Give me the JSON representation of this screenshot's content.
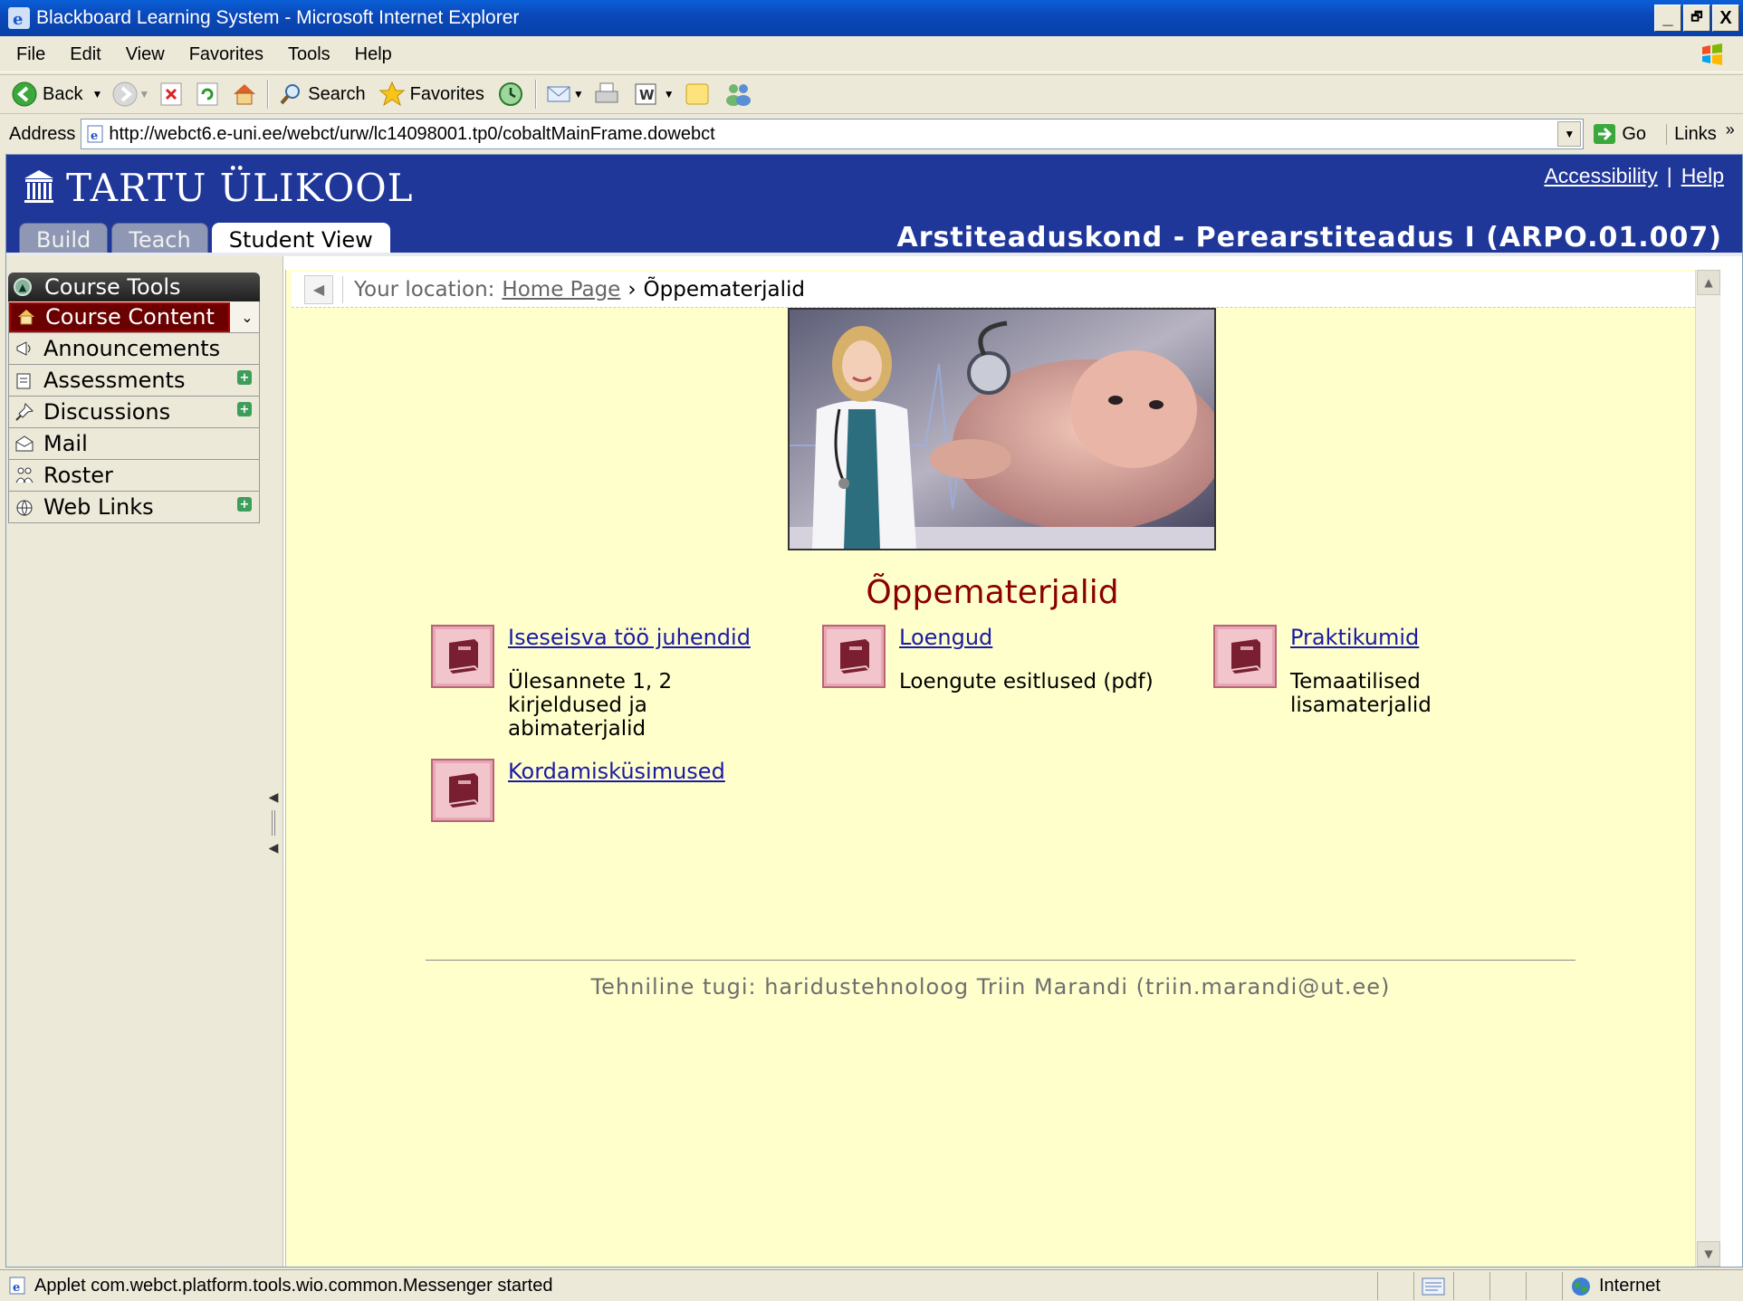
{
  "window": {
    "title": "Blackboard Learning System - Microsoft Internet Explorer",
    "buttons": {
      "minimize": "_",
      "restore": "🗗",
      "close": "X"
    }
  },
  "menu": [
    "File",
    "Edit",
    "View",
    "Favorites",
    "Tools",
    "Help"
  ],
  "toolbar": {
    "back": "Back",
    "search": "Search",
    "favorites": "Favorites"
  },
  "address": {
    "label": "Address",
    "url": "http://webct6.e-uni.ee/webct/urw/lc14098001.tp0/cobaltMainFrame.dowebct",
    "go": "Go",
    "links": "Links"
  },
  "header": {
    "logo": "TARTU ÜLIKOOL",
    "accessibility": "Accessibility",
    "separator": "|",
    "help": "Help",
    "tabs": [
      {
        "label": "Build",
        "active": false
      },
      {
        "label": "Teach",
        "active": false
      },
      {
        "label": "Student View",
        "active": true
      }
    ],
    "course_title": "Arstiteaduskond - Perearstiteadus I (ARPO.01.007)"
  },
  "course_tools": {
    "heading": "Course Tools",
    "items": [
      {
        "label": "Course Content",
        "icon": "home-icon",
        "active": true,
        "plus": false
      },
      {
        "label": "Announcements",
        "icon": "megaphone-icon",
        "active": false,
        "plus": false
      },
      {
        "label": "Assessments",
        "icon": "assessment-icon",
        "active": false,
        "plus": true
      },
      {
        "label": "Discussions",
        "icon": "pin-icon",
        "active": false,
        "plus": true
      },
      {
        "label": "Mail",
        "icon": "mail-icon",
        "active": false,
        "plus": false
      },
      {
        "label": "Roster",
        "icon": "people-icon",
        "active": false,
        "plus": false
      },
      {
        "label": "Web Links",
        "icon": "globe-icon",
        "active": false,
        "plus": true
      }
    ]
  },
  "breadcrumb": {
    "prefix": "Your location:",
    "home": "Home Page",
    "arrow": "›",
    "current": "Õppematerjalid"
  },
  "content": {
    "heading": "Õppematerjalid",
    "folders": [
      {
        "title": "Iseseisva töö juhendid",
        "description": "Ülesannete 1, 2 kirjeldused ja abimaterjalid"
      },
      {
        "title": "Loengud",
        "description": "Loengute esitlused (pdf)"
      },
      {
        "title": "Praktikumid",
        "description": "Temaatilised lisamaterjalid"
      },
      {
        "title": "Kordamisküsimused",
        "description": ""
      }
    ],
    "footer": "Tehniline tugi: haridustehnoloog Triin Marandi (triin.marandi@ut.ee)"
  },
  "status": {
    "text": "Applet com.webct.platform.tools.wio.common.Messenger started",
    "zone": "Internet"
  },
  "colors": {
    "banner": "#20379a",
    "content_bg": "#ffffcc",
    "heading": "#8b0000",
    "link": "#1a1aa6"
  }
}
